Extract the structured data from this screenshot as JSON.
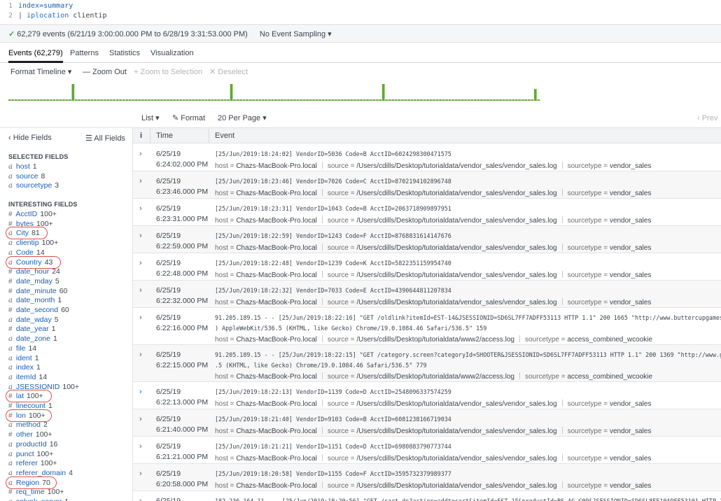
{
  "query": {
    "lines": [
      {
        "num": "1",
        "text": "index=summary"
      },
      {
        "num": "2",
        "pipe": "|",
        "command": "iplocation",
        "arg": "clientip"
      }
    ]
  },
  "status": {
    "check_icon": "check-icon",
    "summary": "62,279 events (6/21/19 3:00:00.000 PM to 6/28/19 3:31:53.000 PM)",
    "sampling": "No Event Sampling ▾"
  },
  "tabs": [
    {
      "label": "Events (62,279)",
      "active": true
    },
    {
      "label": "Patterns"
    },
    {
      "label": "Statistics"
    },
    {
      "label": "Visualization"
    }
  ],
  "timeline_tools": {
    "format": "Format Timeline ▾",
    "zoom_out": "— Zoom Out",
    "zoom_selection": "+ Zoom to Selection",
    "deselect": "✕ Deselect"
  },
  "timeline": {
    "bar_color": "#65a637",
    "bars": [
      0.08,
      0.08,
      0.08,
      0.08,
      0.08,
      0.08,
      0.08,
      0.08,
      0.08,
      0.08,
      0.08,
      0.08,
      0.08,
      0.08,
      0.08,
      0.08,
      0.08,
      0.08,
      0.08,
      0.08,
      0.08,
      0.08,
      0.08,
      0.08,
      0.08,
      0.08,
      0.08,
      0.08,
      0.08,
      0.08,
      0.08,
      0.08,
      0.08,
      0.08,
      0.08,
      0.08,
      0.08,
      0.08,
      0.08,
      0.08,
      0.08,
      0.08,
      0.08,
      0.08,
      0.08,
      0.08,
      0.08,
      0.08,
      0.08,
      0.08,
      0.08,
      0.08,
      0.08,
      0.08,
      0.08,
      0.08,
      0.08,
      0.08,
      0.08,
      0.08,
      0.08,
      0.08,
      0.08,
      0.08,
      0.08,
      0.08,
      0.08,
      0.08,
      0.08,
      0.08,
      0.08,
      0.08,
      0.08,
      0.08,
      0.08,
      0.08,
      0.08,
      0.08,
      0.08,
      0.08,
      0.08,
      0.08,
      0.08,
      0.08,
      0.08,
      0.08,
      0.08,
      0.08,
      0.08,
      0.08,
      0.08,
      0.08,
      0.08,
      0.08,
      0.08,
      0.08,
      0.08,
      0.08,
      0.08,
      0.08,
      0.08,
      0.08,
      0.08,
      0.08,
      0.08,
      0.08,
      0.08,
      0.08,
      0.08,
      0.08,
      0.08,
      0.08,
      0.08,
      0.08,
      0.08,
      0.08,
      0.08,
      0.08,
      0.08,
      0.08,
      0.08,
      0.08,
      0.08,
      0.08,
      0.08,
      0.08,
      0.08,
      0.08,
      0.08,
      0.08,
      0.08,
      0.08,
      0.08,
      0.08,
      0.08,
      0.08,
      0.08,
      0.08,
      0.08,
      0.08,
      0.08,
      0.08,
      0.08,
      0.08,
      0.08,
      0.08,
      0.08,
      0.08,
      0.08,
      0.08,
      0.08,
      0.08,
      0.08,
      0.08,
      0.08,
      0.08,
      0.08,
      0.08,
      0.08,
      0.08,
      0.08,
      0.08,
      0.08,
      0.08,
      0.08,
      0.08,
      0.08,
      0.08
    ],
    "peaks": [
      {
        "index": 20,
        "value": 1.0
      },
      {
        "index": 70,
        "value": 1.0
      },
      {
        "index": 118,
        "value": 1.0
      },
      {
        "index": 166,
        "value": 0.7
      }
    ]
  },
  "results_tools": {
    "list": "List ▾",
    "format": "✎ Format",
    "per_page": "20 Per Page ▾",
    "prev": "‹ Prev"
  },
  "sidebar": {
    "hide_fields": "‹ Hide Fields",
    "all_fields": "☰ All Fields",
    "selected_title": "SELECTED FIELDS",
    "selected": [
      {
        "type": "a",
        "name": "host",
        "count": "1"
      },
      {
        "type": "a",
        "name": "source",
        "count": "8"
      },
      {
        "type": "a",
        "name": "sourcetype",
        "count": "3"
      }
    ],
    "interesting_title": "INTERESTING FIELDS",
    "interesting": [
      {
        "type": "#",
        "name": "AcctID",
        "count": "100+"
      },
      {
        "type": "#",
        "name": "bytes",
        "count": "100+"
      },
      {
        "type": "a",
        "name": "City",
        "count": "81",
        "circled": true
      },
      {
        "type": "a",
        "name": "clientip",
        "count": "100+"
      },
      {
        "type": "a",
        "name": "Code",
        "count": "14"
      },
      {
        "type": "a",
        "name": "Country",
        "count": "43",
        "circled": true
      },
      {
        "type": "#",
        "name": "date_hour",
        "count": "24"
      },
      {
        "type": "#",
        "name": "date_mday",
        "count": "5"
      },
      {
        "type": "#",
        "name": "date_minute",
        "count": "60"
      },
      {
        "type": "a",
        "name": "date_month",
        "count": "1"
      },
      {
        "type": "#",
        "name": "date_second",
        "count": "60"
      },
      {
        "type": "a",
        "name": "date_wday",
        "count": "5"
      },
      {
        "type": "#",
        "name": "date_year",
        "count": "1"
      },
      {
        "type": "a",
        "name": "date_zone",
        "count": "1"
      },
      {
        "type": "a",
        "name": "file",
        "count": "14"
      },
      {
        "type": "a",
        "name": "ident",
        "count": "1"
      },
      {
        "type": "a",
        "name": "index",
        "count": "1"
      },
      {
        "type": "a",
        "name": "itemId",
        "count": "14"
      },
      {
        "type": "a",
        "name": "JSESSIONID",
        "count": "100+"
      },
      {
        "type": "#",
        "name": "lat",
        "count": "100+",
        "circled": true
      },
      {
        "type": "#",
        "name": "linecount",
        "count": "1"
      },
      {
        "type": "#",
        "name": "lon",
        "count": "100+",
        "circled": true
      },
      {
        "type": "a",
        "name": "method",
        "count": "2"
      },
      {
        "type": "#",
        "name": "other",
        "count": "100+"
      },
      {
        "type": "a",
        "name": "productId",
        "count": "16"
      },
      {
        "type": "a",
        "name": "punct",
        "count": "100+"
      },
      {
        "type": "a",
        "name": "referer",
        "count": "100+"
      },
      {
        "type": "a",
        "name": "referer_domain",
        "count": "4"
      },
      {
        "type": "a",
        "name": "Region",
        "count": "70",
        "circled": true
      },
      {
        "type": "#",
        "name": "req_time",
        "count": "100+"
      },
      {
        "type": "a",
        "name": "splunk_server",
        "count": "1"
      }
    ]
  },
  "table": {
    "col_info": "i",
    "col_time": "Time",
    "col_event": "Event",
    "host_key": "host =",
    "source_key": "source =",
    "sourcetype_key": "sourcetype =",
    "rows": [
      {
        "date": "6/25/19",
        "time": "6:24:02.000 PM",
        "raw": "[25/Jun/2019:18:24:02] VendorID=5036 Code=B AcctID=6024298300471575",
        "host": "Chazs-MacBook-Pro.local",
        "source": "/Users/cdills/Desktop/tutorialdata/vendor_sales/vendor_sales.log",
        "sourcetype": "vendor_sales"
      },
      {
        "date": "6/25/19",
        "time": "6:23:46.000 PM",
        "raw": "[25/Jun/2019:18:23:46] VendorID=7026 Code=C AcctID=8702194102896748",
        "host": "Chazs-MacBook-Pro.local",
        "source": "/Users/cdills/Desktop/tutorialdata/vendor_sales/vendor_sales.log",
        "sourcetype": "vendor_sales"
      },
      {
        "date": "6/25/19",
        "time": "6:23:31.000 PM",
        "raw": "[25/Jun/2019:18:23:31] VendorID=1043 Code=B AcctID=2063718909897951",
        "host": "Chazs-MacBook-Pro.local",
        "source": "/Users/cdills/Desktop/tutorialdata/vendor_sales/vendor_sales.log",
        "sourcetype": "vendor_sales"
      },
      {
        "date": "6/25/19",
        "time": "6:22:59.000 PM",
        "raw": "[25/Jun/2019:18:22:59] VendorID=1243 Code=F AcctID=8768831614147676",
        "host": "Chazs-MacBook-Pro.local",
        "source": "/Users/cdills/Desktop/tutorialdata/vendor_sales/vendor_sales.log",
        "sourcetype": "vendor_sales"
      },
      {
        "date": "6/25/19",
        "time": "6:22:48.000 PM",
        "raw": "[25/Jun/2019:18:22:48] VendorID=1239 Code=K AcctID=5822351159954740",
        "host": "Chazs-MacBook-Pro.local",
        "source": "/Users/cdills/Desktop/tutorialdata/vendor_sales/vendor_sales.log",
        "sourcetype": "vendor_sales"
      },
      {
        "date": "6/25/19",
        "time": "6:22:32.000 PM",
        "raw": "[25/Jun/2019:18:22:32] VendorID=7033 Code=E AcctID=4390644811207834",
        "host": "Chazs-MacBook-Pro.local",
        "source": "/Users/cdills/Desktop/tutorialdata/vendor_sales/vendor_sales.log",
        "sourcetype": "vendor_sales"
      },
      {
        "date": "6/25/19",
        "time": "6:22:16.000 PM",
        "raw": "91.205.189.15 - - [25/Jun/2019:18:22:16] \"GET /oldlink?itemId=EST-14&JSESSIONID=SD6SL7FF7ADFF53113 HTTP 1.1\" 200 1665 \"http://www.buttercupgames.com/old",
        "raw2": ") AppleWebKit/536.5 (KHTML, like Gecko) Chrome/19.0.1084.46 Safari/536.5\" 159",
        "host": "Chazs-MacBook-Pro.local",
        "source": "/Users/cdills/Desktop/tutorialdata/www2/access.log",
        "sourcetype": "access_combined_wcookie"
      },
      {
        "date": "6/25/19",
        "time": "6:22:15.000 PM",
        "raw": "91.205.189.15 - - [25/Jun/2019:18:22:15] \"GET /category.screen?categoryId=SHOOTER&JSESSIONID=SD6SL7FF7ADFF53113 HTTP 1.1\" 200 1369 \"http://www.google.co",
        "raw2": ".5 (KHTML, like Gecko) Chrome/19.0.1084.46 Safari/536.5\" 779",
        "host": "Chazs-MacBook-Pro.local",
        "source": "/Users/cdills/Desktop/tutorialdata/www2/access.log",
        "sourcetype": "access_combined_wcookie"
      },
      {
        "date": "6/25/19",
        "time": "6:22:13.000 PM",
        "raw": "[25/Jun/2019:18:22:13] VendorID=1139 Code=D AcctID=2548096337574259",
        "host": "Chazs-MacBook-Pro.local",
        "source": "/Users/cdills/Desktop/tutorialdata/vendor_sales/vendor_sales.log",
        "sourcetype": "vendor_sales",
        "blue": true
      },
      {
        "date": "6/25/19",
        "time": "6:21:40.000 PM",
        "raw": "[25/Jun/2019:18:21:40] VendorID=9103 Code=B AcctID=6081238166719034",
        "host": "Chazs-MacBook-Pro.local",
        "source": "/Users/cdills/Desktop/tutorialdata/vendor_sales/vendor_sales.log",
        "sourcetype": "vendor_sales"
      },
      {
        "date": "6/25/19",
        "time": "6:21:21.000 PM",
        "raw": "[25/Jun/2019:18:21:21] VendorID=1151 Code=D AcctID=6980883790773744",
        "host": "Chazs-MacBook-Pro.local",
        "source": "/Users/cdills/Desktop/tutorialdata/vendor_sales/vendor_sales.log",
        "sourcetype": "vendor_sales"
      },
      {
        "date": "6/25/19",
        "time": "6:20:58.000 PM",
        "raw": "[25/Jun/2019:18:20:58] VendorID=1155 Code=F AcctID=3595732379989377",
        "host": "Chazs-MacBook-Pro.local",
        "source": "/Users/cdills/Desktop/tutorialdata/vendor_sales/vendor_sales.log",
        "sourcetype": "vendor_sales"
      },
      {
        "date": "6/25/19",
        "time": "",
        "raw": "182.236.164.11 - - [25/Jun/2019:18:20:56] \"GET /cart.do?action=addtocart&itemId=EST-15&productId=BS-AG-G09&JSESSIONID=SD6SL8FF10ADFF53101 HTTP 1.1\" 200 1",
        "host": "",
        "source": "",
        "sourcetype": ""
      }
    ]
  }
}
